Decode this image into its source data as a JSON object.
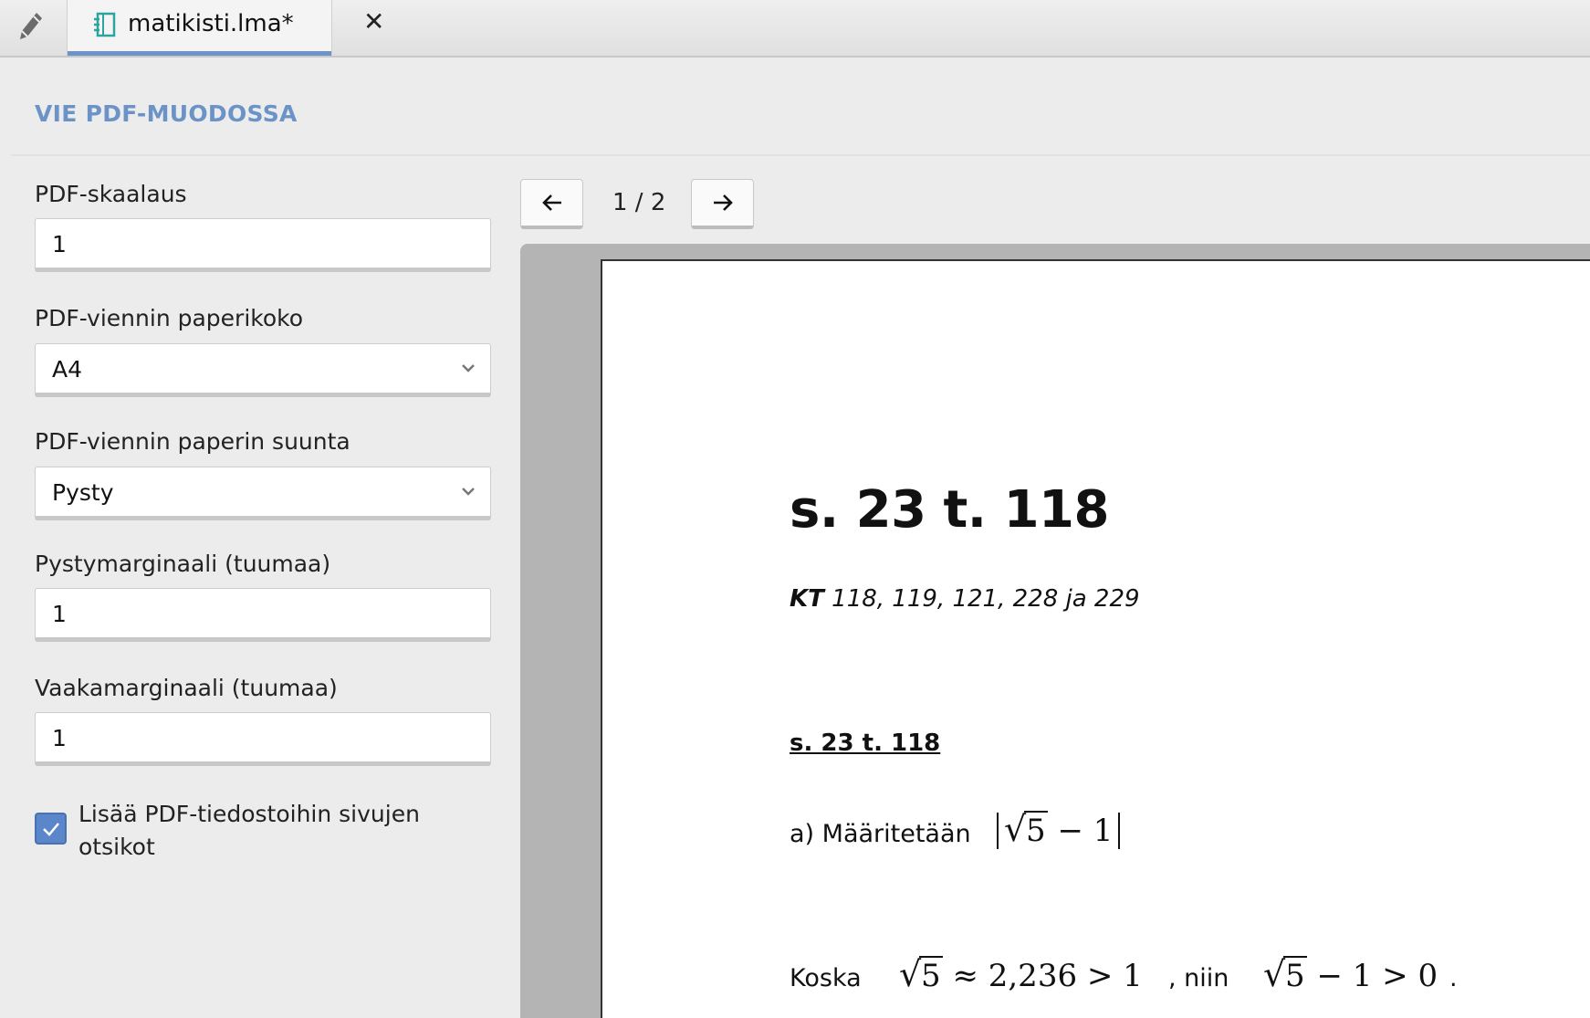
{
  "tab": {
    "title": "matikisti.lma*",
    "close": "✕"
  },
  "section": {
    "title": "VIE PDF-MUODOSSA"
  },
  "form": {
    "scale_label": "PDF-skaalaus",
    "scale_value": "1",
    "paper_size_label": "PDF-viennin paperikoko",
    "paper_size_value": "A4",
    "orientation_label": "PDF-viennin paperin suunta",
    "orientation_value": "Pysty",
    "vmargin_label": "Pystymarginaali (tuumaa)",
    "vmargin_value": "1",
    "hmargin_label": "Vaakamarginaali (tuumaa)",
    "hmargin_value": "1",
    "headers_checkbox_label": "Lisää PDF-tiedostoihin sivujen otsikot",
    "headers_checked": true
  },
  "nav": {
    "page_indicator": "1 / 2"
  },
  "document": {
    "heading": "s. 23 t. 118",
    "subtitle_bold": "KT",
    "subtitle_rest": " 118, 119, 121, 228 ja 229",
    "subheading": "s. 23 t. 118",
    "line_a_text": "a) Määritetään",
    "line_a_rad": "5",
    "line_a_rest": " − 1",
    "line_b_text": "Koska",
    "line_b_rad": "5",
    "line_b_math1": " ≈ 2,236  >  1",
    "line_b_mid": ", niin",
    "line_b_rad2": "5",
    "line_b_math2": " − 1 > 0",
    "line_b_dot": "."
  },
  "icons": {
    "pencil": "pencil-icon",
    "notebook": "notebook-icon",
    "close": "close-icon",
    "chevron": "chevron-down-icon",
    "prev": "arrow-left-icon",
    "next": "arrow-right-icon",
    "check": "check-icon"
  },
  "colors": {
    "accent": "#6b93c8",
    "tab_underline": "#6d93c9",
    "checkbox": "#5b86c9",
    "notebook_icon": "#2aa6a0"
  }
}
